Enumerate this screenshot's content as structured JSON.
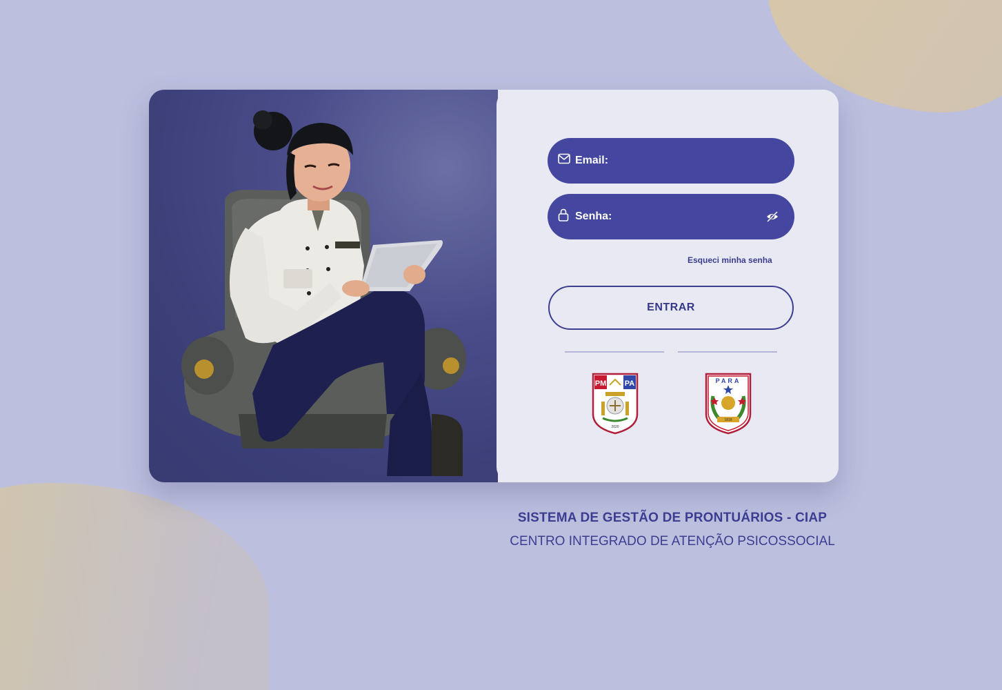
{
  "login": {
    "email_label": "Email:",
    "password_label": "Senha:",
    "forgot_password": "Esqueci minha senha",
    "submit_label": "ENTRAR"
  },
  "crests": {
    "left_badge_left": "PM",
    "left_badge_right": "PA",
    "left_year": "2020",
    "right_top_text": "PARA",
    "right_year": "1818"
  },
  "footer": {
    "title": "SISTEMA DE GESTÃO DE PRONTUÁRIOS - CIAP",
    "subtitle": "CENTRO INTEGRADO DE ATENÇÃO PSICOSSOCIAL"
  },
  "colors": {
    "background": "#bdbfdf",
    "field": "#4446a0",
    "accent_text": "#3b3d90",
    "hero": "#3c3f78",
    "panel": "#e9e9f3"
  },
  "icons": {
    "email": "mail-icon",
    "password": "lock-icon",
    "visibility": "eye-off-icon"
  }
}
